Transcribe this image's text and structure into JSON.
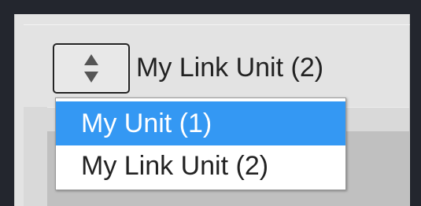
{
  "unit_selector": {
    "current_value": "My Link Unit (2)",
    "selected_index": 0,
    "options": [
      "My Unit (1)",
      "My Link Unit (2)"
    ]
  },
  "colors": {
    "highlight": "#3498f3",
    "background": "#23262e",
    "panel": "#e3e3e3"
  },
  "icons": {
    "spinner": "up-down-arrows-icon"
  }
}
